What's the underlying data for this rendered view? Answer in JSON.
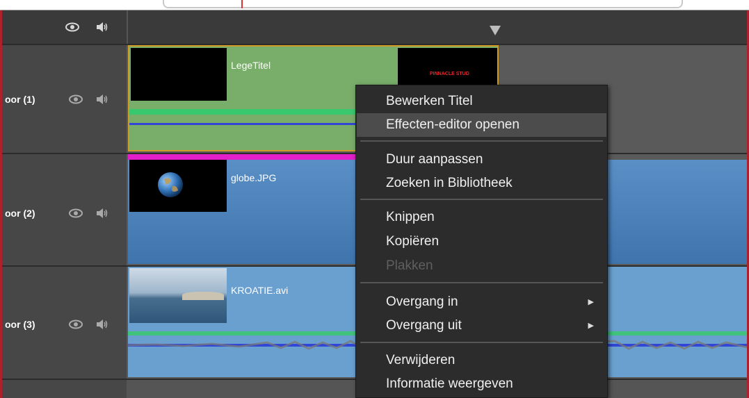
{
  "tracks": [
    {
      "name": "oor (1)",
      "clip_title": "LegeTitel",
      "title_overlay": "PINNACLE STUD"
    },
    {
      "name": "oor (2)",
      "clip_title": "globe.JPG"
    },
    {
      "name": "oor (3)",
      "clip_title": "KROATIE.avi"
    }
  ],
  "icons": {
    "eye": "eye-icon",
    "speaker": "speaker-icon",
    "submenu": "chevron-right-icon"
  },
  "colors": {
    "title_clip": "#79ad6a",
    "image_clip": "#4f86bd",
    "video_clip": "#6aa0cf",
    "selection_border": "#d09b28",
    "menu_bg": "#2c2c2c",
    "menu_highlight": "#4c4c4c",
    "magenta_bar": "#e21fc8",
    "green_line": "#39c86d",
    "blue_line": "#3145d6"
  },
  "context_menu": {
    "items": [
      {
        "label": "Bewerken Titel"
      },
      {
        "label": "Effecten-editor openen",
        "highlighted": true
      },
      {
        "label": "Duur aanpassen"
      },
      {
        "label": "Zoeken in Bibliotheek"
      },
      {
        "label": "Knippen"
      },
      {
        "label": "Kopiëren"
      },
      {
        "label": "Plakken",
        "disabled": true
      },
      {
        "label": "Overgang in",
        "submenu": true
      },
      {
        "label": "Overgang uit",
        "submenu": true
      },
      {
        "label": "Verwijderen"
      },
      {
        "label": "Informatie weergeven"
      }
    ]
  }
}
